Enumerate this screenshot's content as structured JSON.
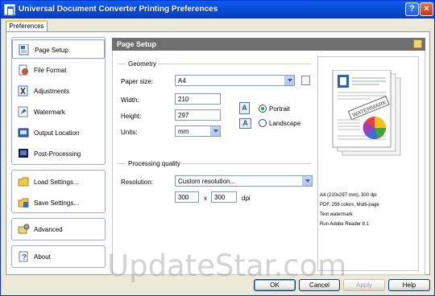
{
  "window": {
    "title": "Universal Document Converter Printing Preferences",
    "help_btn": "?",
    "close_btn": "×"
  },
  "tabs": [
    {
      "label": "Preferences"
    }
  ],
  "nav": {
    "group1": [
      {
        "label": "Page Setup",
        "icon": "page-setup-icon"
      },
      {
        "label": "File Format",
        "icon": "file-format-icon"
      },
      {
        "label": "Adjustments",
        "icon": "adjustments-icon"
      },
      {
        "label": "Watermark",
        "icon": "watermark-icon"
      },
      {
        "label": "Output Location",
        "icon": "output-location-icon"
      },
      {
        "label": "Post-Processing",
        "icon": "post-processing-icon"
      }
    ],
    "group2": [
      {
        "label": "Load Settings...",
        "icon": "load-settings-icon"
      },
      {
        "label": "Save Settings...",
        "icon": "save-settings-icon"
      }
    ],
    "group3": [
      {
        "label": "Advanced",
        "icon": "advanced-icon"
      }
    ],
    "group4": [
      {
        "label": "About",
        "icon": "about-icon"
      }
    ]
  },
  "header": {
    "title": "Page Setup"
  },
  "geometry": {
    "group_label": "Geometry",
    "paper_size_label": "Paper size:",
    "paper_size_value": "A4",
    "width_label": "Width:",
    "width_value": "210",
    "height_label": "Height:",
    "height_value": "297",
    "units_label": "Units:",
    "units_value": "mm",
    "portrait_label": "Portrait",
    "landscape_label": "Landscape",
    "orientation_selected": "Portrait"
  },
  "quality": {
    "group_label": "Processing quality",
    "resolution_label": "Resolution:",
    "resolution_value": "Custom resolution...",
    "dpi_x": "300",
    "times": "x",
    "dpi_y": "300",
    "dpi_unit": "dpi"
  },
  "preview": {
    "watermark_text": "WATERMARK",
    "lines": [
      "A4 (210x297 mm), 300 dpi",
      "PDF, 256 colors, Multi-page",
      "Text watermark",
      "Run Adobe Reader 8.1"
    ]
  },
  "buttons": {
    "ok": "OK",
    "cancel": "Cancel",
    "apply": "Apply",
    "help": "Help"
  },
  "overlay": {
    "watermark": "UpdateStar.com"
  },
  "colors": {
    "title_bar": "#0a4fd8",
    "header_bar": "#6f6f6f",
    "selected_border": "#8ca2d4"
  }
}
